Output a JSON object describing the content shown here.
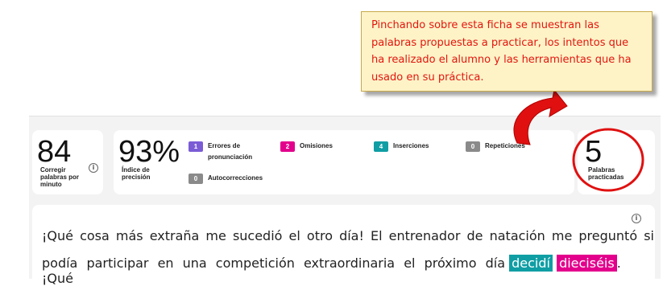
{
  "callout": {
    "text": "Pinchando sobre esta ficha se muestran las palabras propuestas a practicar, los intentos que ha realizado el alumno y las herramientas que ha usado en su práctica."
  },
  "metrics": {
    "wcpm": {
      "value": "84",
      "label": "Corregir palabras por minuto"
    },
    "accuracy": {
      "value": "93%",
      "label": "Índice de precisión"
    },
    "practiced": {
      "value": "5",
      "label": "Palabras practicadas"
    }
  },
  "errors": [
    {
      "count": "1",
      "label": "Errores de pronunciación",
      "color": "#7b5cd6"
    },
    {
      "count": "2",
      "label": "Omisiones",
      "color": "#e3008c"
    },
    {
      "count": "4",
      "label": "Inserciones",
      "color": "#0f9ea4"
    },
    {
      "count": "0",
      "label": "Repeticiones",
      "color": "#8a8a8a"
    },
    {
      "count": "0",
      "label": "Autocorrecciones",
      "color": "#8a8a8a"
    }
  ],
  "passage": {
    "line1": "¡Qué cosa más extraña me sucedió el otro día! El entrenador de natación me preguntó si",
    "line2_pre": "podía participar en una competición extraordinaria el próximo día",
    "word_insert": "decidí",
    "word_omit": "dieciséis",
    "line2_post": ". ¡Qué"
  },
  "icons": {
    "info": "ⓘ"
  }
}
